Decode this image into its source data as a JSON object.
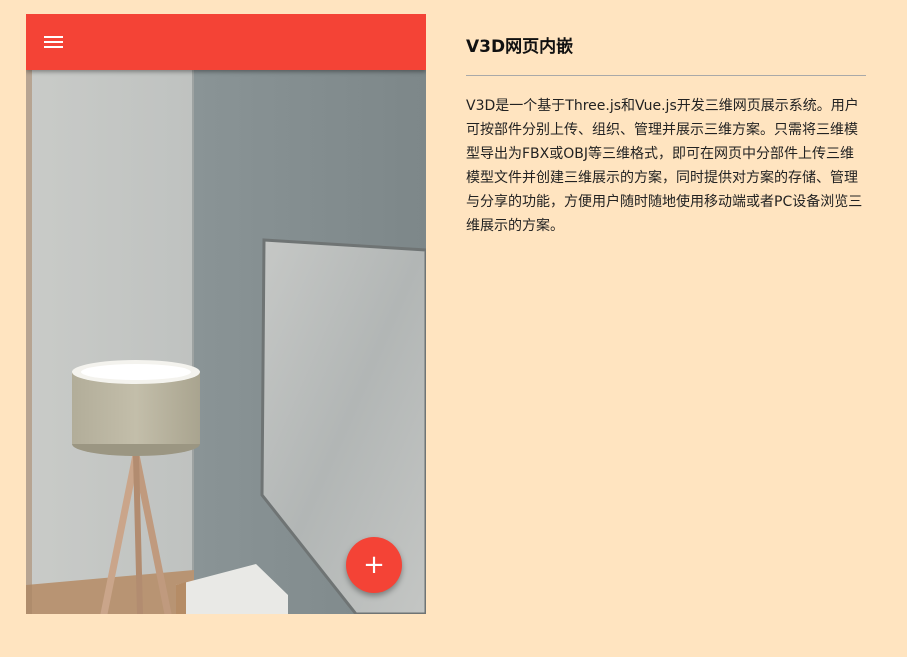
{
  "app": {
    "menu_icon": "menu-icon",
    "fab_icon": "plus-icon",
    "fab_label": "+",
    "accent_color": "#f44336",
    "background_color": "#ffe4c0"
  },
  "article": {
    "title": "V3D网页内嵌",
    "body": "V3D是一个基于Three.js和Vue.js开发三维网页展示系统。用户可按部件分别上传、组织、管理并展示三维方案。只需将三维模型导出为FBX或OBJ等三维格式，即可在网页中分部件上传三维模型文件并创建三维展示的方案，同时提供对方案的存储、管理与分享的功能，方便用户随时随地使用移动端或者PC设备浏览三维展示的方案。"
  }
}
